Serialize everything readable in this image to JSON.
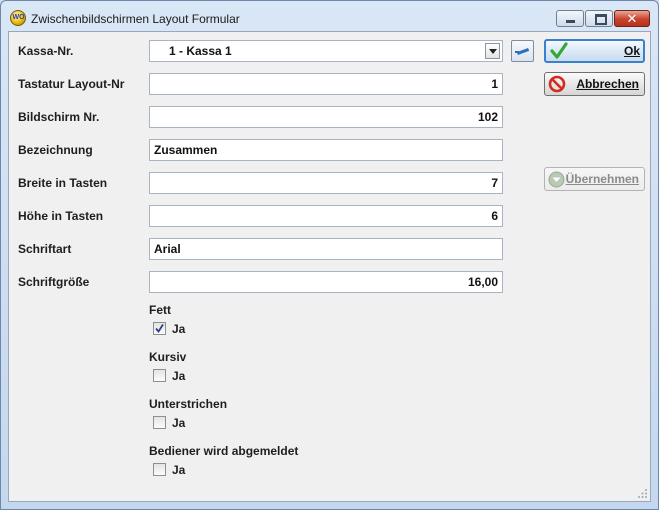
{
  "window": {
    "title": "Zwischenbildschirmen Layout Formular",
    "app_icon_text": "WO",
    "close_glyph": "✕"
  },
  "form": {
    "kassa_label": "Kassa-Nr.",
    "kassa_value": "1 - Kassa 1",
    "tastatur_label": "Tastatur Layout-Nr",
    "tastatur_value": "1",
    "bildschirm_label": "Bildschirm Nr.",
    "bildschirm_value": "102",
    "bezeichnung_label": "Bezeichnung",
    "bezeichnung_value": "Zusammen",
    "breite_label": "Breite in Tasten",
    "breite_value": "7",
    "hoehe_label": "Höhe in Tasten",
    "hoehe_value": "6",
    "schriftart_label": "Schriftart",
    "schriftart_value": "Arial",
    "schriftgroesse_label": "Schriftgröße",
    "schriftgroesse_value": "16,00"
  },
  "options": {
    "fett": {
      "label": "Fett",
      "check_label": "Ja",
      "checked": true
    },
    "kursiv": {
      "label": "Kursiv",
      "check_label": "Ja",
      "checked": false
    },
    "unterstrichen": {
      "label": "Unterstrichen",
      "check_label": "Ja",
      "checked": false
    },
    "bediener": {
      "label": "Bediener wird abgemeldet",
      "check_label": "Ja",
      "checked": false
    }
  },
  "buttons": {
    "ok_label": "Ok",
    "cancel_label": "Abbrechen",
    "apply_label": "Übernehmen",
    "apply_enabled": false
  },
  "colors": {
    "accent": "#3a80cf",
    "ok_check": "#35a832",
    "cancel_red": "#d42a1f",
    "disabled": "#8a8a8a"
  },
  "icons": {
    "app": "app-logo-icon",
    "minimize": "minimize-icon",
    "maximize": "maximize-icon",
    "close": "close-icon",
    "dropdown": "chevron-down-icon",
    "edit": "edit-pen-icon",
    "ok": "checkmark-icon",
    "cancel": "stop-icon",
    "apply": "arrow-down-icon",
    "resize": "resize-grip-icon"
  }
}
